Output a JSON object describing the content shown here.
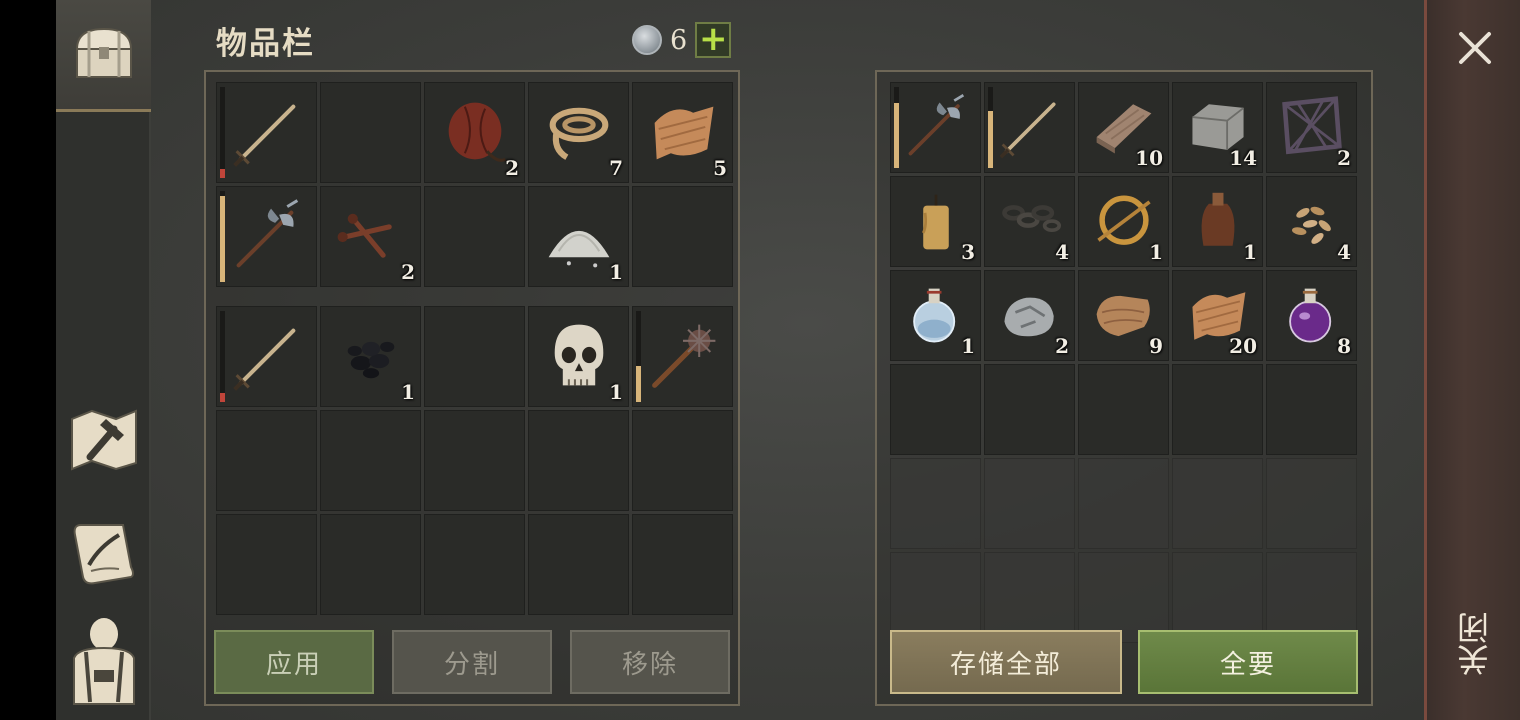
{
  "title": "物品栏",
  "currency": {
    "icon": "silver-coin-icon",
    "amount": "6",
    "add_label": "+"
  },
  "inventory": {
    "slots_top": [
      {
        "icon": "sword-icon",
        "qty": "",
        "durability": 0.1,
        "dur_color": "#c0453a"
      },
      {
        "icon": "",
        "qty": ""
      },
      {
        "icon": "waterskin-icon",
        "qty": "2"
      },
      {
        "icon": "rope-icon",
        "qty": "7"
      },
      {
        "icon": "cloth-icon",
        "qty": "5"
      },
      {
        "icon": "halberd-icon",
        "qty": "",
        "durability": 0.95,
        "dur_color": "#d8b57a"
      },
      {
        "icon": "nails-icon",
        "qty": "2"
      },
      {
        "icon": "",
        "qty": ""
      },
      {
        "icon": "salt-pile-icon",
        "qty": "1"
      },
      {
        "icon": "",
        "qty": ""
      }
    ],
    "slots_bottom": [
      {
        "icon": "sword-icon",
        "qty": "",
        "durability": 0.1,
        "dur_color": "#c0453a"
      },
      {
        "icon": "coal-icon",
        "qty": "1"
      },
      {
        "icon": "",
        "qty": ""
      },
      {
        "icon": "skull-icon",
        "qty": "1"
      },
      {
        "icon": "mace-icon",
        "qty": "",
        "durability": 0.4,
        "dur_color": "#d8b57a"
      },
      {
        "icon": "",
        "qty": ""
      },
      {
        "icon": "",
        "qty": ""
      },
      {
        "icon": "",
        "qty": ""
      },
      {
        "icon": "",
        "qty": ""
      },
      {
        "icon": "",
        "qty": ""
      },
      {
        "icon": "",
        "qty": ""
      },
      {
        "icon": "",
        "qty": ""
      },
      {
        "icon": "",
        "qty": ""
      },
      {
        "icon": "",
        "qty": ""
      },
      {
        "icon": "",
        "qty": ""
      }
    ],
    "buttons": {
      "apply": "应用",
      "split": "分割",
      "remove": "移除"
    }
  },
  "container": {
    "slots": [
      {
        "icon": "halberd-icon",
        "qty": "",
        "durability": 0.8,
        "dur_color": "#d8b57a"
      },
      {
        "icon": "sword-icon",
        "qty": "",
        "durability": 0.7,
        "dur_color": "#d8b57a"
      },
      {
        "icon": "wooden-plank-icon",
        "qty": "10"
      },
      {
        "icon": "stone-block-icon",
        "qty": "14"
      },
      {
        "icon": "iron-grate-icon",
        "qty": "2"
      },
      {
        "icon": "candle-icon",
        "qty": "3"
      },
      {
        "icon": "chain-icon",
        "qty": "4"
      },
      {
        "icon": "brooch-icon",
        "qty": "1"
      },
      {
        "icon": "leather-flask-icon",
        "qty": "1"
      },
      {
        "icon": "seeds-icon",
        "qty": "4"
      },
      {
        "icon": "water-potion-icon",
        "qty": "1"
      },
      {
        "icon": "iron-ore-icon",
        "qty": "2"
      },
      {
        "icon": "leather-roll-icon",
        "qty": "9"
      },
      {
        "icon": "cloth-icon",
        "qty": "20"
      },
      {
        "icon": "purple-potion-icon",
        "qty": "8"
      },
      {
        "icon": "",
        "qty": ""
      },
      {
        "icon": "",
        "qty": ""
      },
      {
        "icon": "",
        "qty": ""
      },
      {
        "icon": "",
        "qty": ""
      },
      {
        "icon": "",
        "qty": ""
      },
      {
        "icon": "",
        "qty": "",
        "dim": true
      },
      {
        "icon": "",
        "qty": "",
        "dim": true
      },
      {
        "icon": "",
        "qty": "",
        "dim": true
      },
      {
        "icon": "",
        "qty": "",
        "dim": true
      },
      {
        "icon": "",
        "qty": "",
        "dim": true
      },
      {
        "icon": "",
        "qty": "",
        "dim": true
      },
      {
        "icon": "",
        "qty": "",
        "dim": true
      },
      {
        "icon": "",
        "qty": "",
        "dim": true
      },
      {
        "icon": "",
        "qty": "",
        "dim": true
      },
      {
        "icon": "",
        "qty": "",
        "dim": true
      }
    ],
    "buttons": {
      "store_all": "存储全部",
      "take_all": "全要"
    }
  },
  "nav": [
    {
      "icon": "chest-icon",
      "active": true
    },
    {
      "icon": "crafting-hammer-icon"
    },
    {
      "icon": "quest-scroll-icon"
    },
    {
      "icon": "character-icon"
    }
  ],
  "close": {
    "label": "关闭",
    "icon": "close-icon"
  },
  "colors": {
    "accent_green": "#a7be70",
    "close_border": "#7a4a3e",
    "panel_border": "#6e6757"
  }
}
